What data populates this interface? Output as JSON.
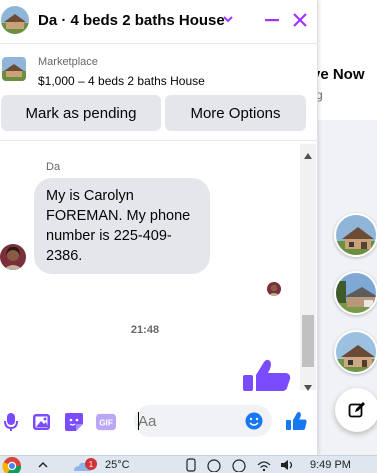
{
  "background_page": {
    "title_partial": "ve Now",
    "subtitle_partial": "rg"
  },
  "chat": {
    "header": {
      "title": "Da · 4 beds 2 baths House",
      "chevron_icon": "chevron-down-icon",
      "minimize_icon": "minimize-icon",
      "close_icon": "close-icon"
    },
    "listing": {
      "source": "Marketplace",
      "title": "$1,000 – 4 beds 2 baths House"
    },
    "actions": {
      "mark_pending_label": "Mark as pending",
      "more_options_label": "More Options"
    },
    "messages": {
      "sender_name": "Da",
      "received_text": "My is Carolyn FOREMAN. My phone number is 225-409-2386.",
      "timestamp": "21:48",
      "sent_item": "thumbs-up-icon"
    },
    "composer": {
      "placeholder": "Aa",
      "icons": [
        "microphone-icon",
        "photo-icon",
        "sticker-icon",
        "gif-icon"
      ],
      "gif_label": "GIF",
      "emoji_icon": "emoji-icon",
      "like_icon": "thumbs-up-icon"
    }
  },
  "taskbar": {
    "weather_badge": "1",
    "temperature": "25°C",
    "time": "9:49 PM"
  },
  "colors": {
    "accent": "#a033ff",
    "messenger_blue": "#0084ff",
    "composer_blue": "#1877f2",
    "like_purple": "#7b4cff"
  }
}
